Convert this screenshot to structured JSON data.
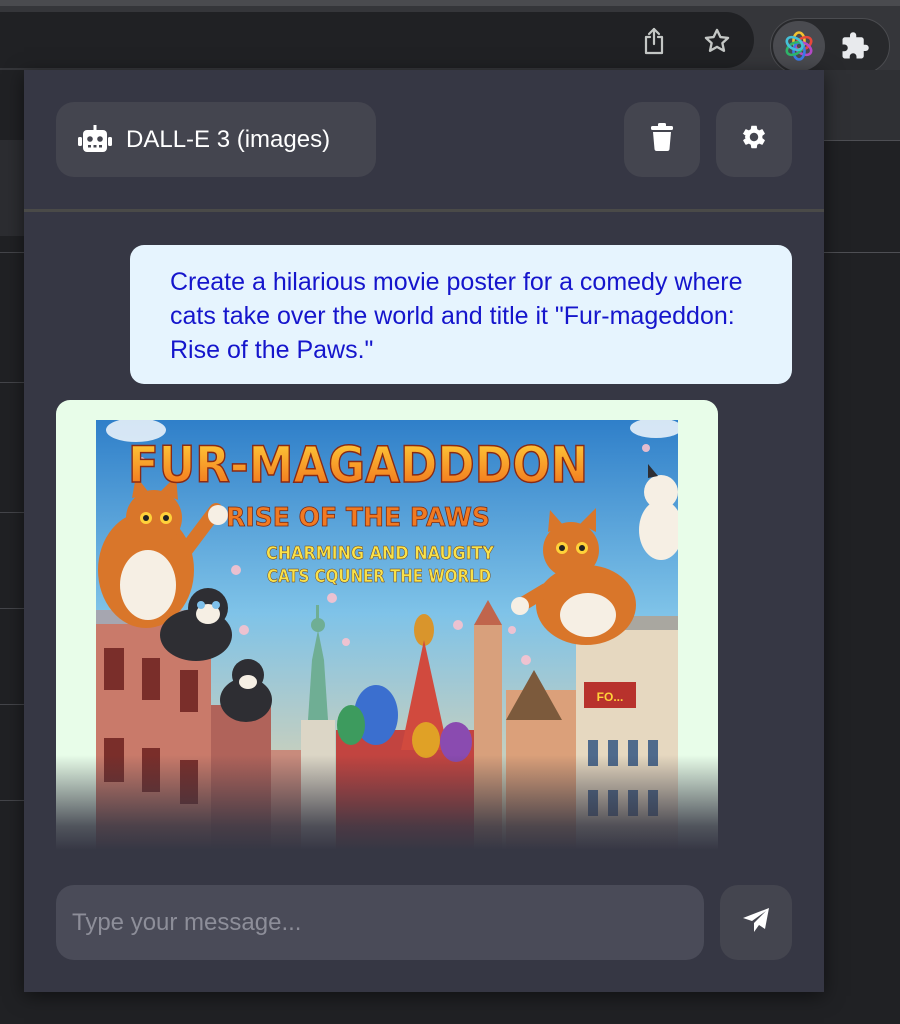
{
  "popup": {
    "model_label": "DALL-E 3 (images)",
    "icons": {
      "model": "robot-icon",
      "clear": "trash-icon",
      "settings": "gear-icon",
      "send": "paper-plane-icon"
    }
  },
  "conversation": {
    "user_message": "Create a hilarious movie poster for a comedy where cats take over the world and title it \"Fur-mageddon: Rise of the Paws.\"",
    "image_text": {
      "title": "FUR-MAGADDDON",
      "subtitle": "RISE OF THE PAWS",
      "tagline_line1": "CHARMING AND NAUGITY",
      "tagline_line2": "CATS CQUNER THE WORLD",
      "sign": "FO..."
    }
  },
  "composer": {
    "placeholder": "Type your message..."
  },
  "colors": {
    "popup_bg": "#363744",
    "control_bg": "#44454f",
    "user_bubble_bg": "#e6f4fe",
    "user_text": "#1515cc",
    "assistant_bubble_bg": "#e8fde9"
  }
}
